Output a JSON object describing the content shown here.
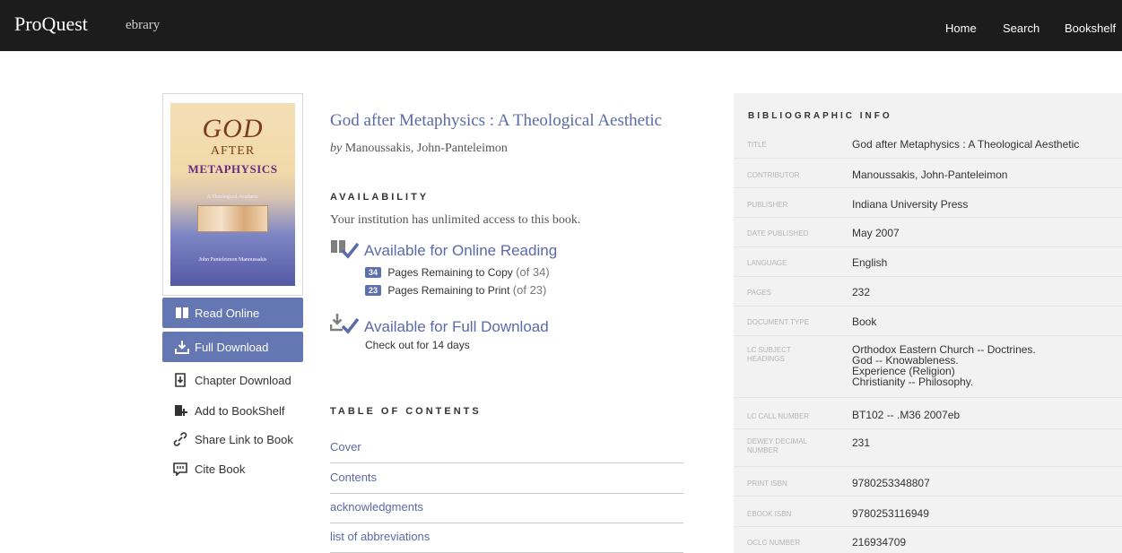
{
  "header": {
    "brand": "ProQuest",
    "brand_sub": "ebrary",
    "nav": [
      "Home",
      "Search",
      "Bookshelf"
    ]
  },
  "cover": {
    "line1": "GOD",
    "line2": "AFTER",
    "line3": "METAPHYSICS",
    "subtitle": "A Theological Aesthetic",
    "author": "John Panteleimon Manoussakis"
  },
  "actions": {
    "read_online": "Read Online",
    "full_download": "Full Download",
    "chapter_download": "Chapter Download",
    "add_bookshelf": "Add to BookShelf",
    "share_link": "Share Link to Book",
    "cite_book": "Cite Book"
  },
  "book": {
    "title": "God after Metaphysics : A Theological Aesthetic",
    "by_prefix": "by",
    "author": "Manoussakis, John-Panteleimon"
  },
  "availability": {
    "heading": "AVAILABILITY",
    "access_text": "Your institution has unlimited access to this book.",
    "online_title": "Available for Online Reading",
    "copy_count": "34",
    "copy_label": "Pages Remaining to Copy",
    "copy_of": "(of 34)",
    "print_count": "23",
    "print_label": "Pages Remaining to Print",
    "print_of": "(of 23)",
    "download_title": "Available for Full Download",
    "checkout": "Check out for 14 days"
  },
  "toc": {
    "heading": "TABLE OF CONTENTS",
    "items": [
      "Cover",
      "Contents",
      "acknowledgments",
      "list of abbreviations"
    ]
  },
  "bibliographic": {
    "heading": "BIBLIOGRAPHIC INFO",
    "rows": [
      {
        "label": "TITLE",
        "value": "God after Metaphysics : A Theological Aesthetic"
      },
      {
        "label": "CONTRIBUTOR",
        "value": "Manoussakis, John-Panteleimon"
      },
      {
        "label": "PUBLISHER",
        "value": "Indiana University Press"
      },
      {
        "label": "DATE PUBLISHED",
        "value": "May 2007"
      },
      {
        "label": "LANGUAGE",
        "value": "English"
      },
      {
        "label": "PAGES",
        "value": "232"
      },
      {
        "label": "DOCUMENT TYPE",
        "value": "Book"
      },
      {
        "label": "LC SUBJECT HEADINGS",
        "value_lines": [
          "Orthodox Eastern Church -- Doctrines.",
          "God -- Knowableness.",
          "Experience (Religion)",
          "Christianity -- Philosophy."
        ]
      },
      {
        "label": "LC CALL NUMBER",
        "value": "BT102 -- .M36 2007eb"
      },
      {
        "label": "DEWEY DECIMAL NUMBER",
        "value": "231"
      },
      {
        "label": "PRINT ISBN",
        "value": "9780253348807"
      },
      {
        "label": "EBOOK ISBN",
        "value": "9780253116949"
      },
      {
        "label": "OCLC NUMBER",
        "value": "216934709"
      }
    ]
  },
  "colors": {
    "topbar": "#1c1c1c",
    "accent": "#6577b3",
    "link": "#5b6aa8",
    "panel": "#f2f2f2"
  }
}
